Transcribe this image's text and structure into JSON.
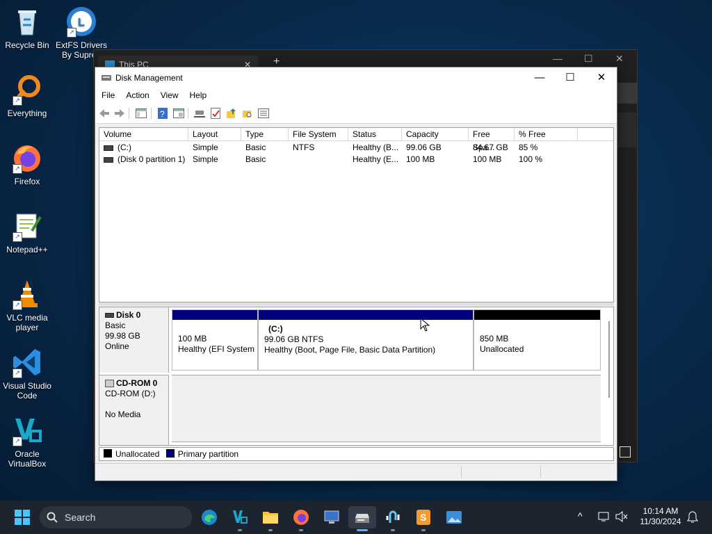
{
  "desktop": {
    "icons": [
      {
        "label": "Recycle Bin"
      },
      {
        "label": "ExtFS Drivers By Supren"
      },
      {
        "label": "Everything"
      },
      {
        "label": "Firefox"
      },
      {
        "label": "Notepad++"
      },
      {
        "label": "VLC media player"
      },
      {
        "label": "Visual Studio Code"
      },
      {
        "label": "Oracle VirtualBox"
      }
    ]
  },
  "background_window": {
    "tab_title": "This PC"
  },
  "window": {
    "title": "Disk Management",
    "menu": [
      "File",
      "Action",
      "View",
      "Help"
    ],
    "columns": [
      "Volume",
      "Layout",
      "Type",
      "File System",
      "Status",
      "Capacity",
      "Free Spa...",
      "% Free"
    ],
    "rows": [
      {
        "volume": "(C:)",
        "layout": "Simple",
        "type": "Basic",
        "fs": "NTFS",
        "status": "Healthy (B...",
        "capacity": "99.06 GB",
        "free": "84.67 GB",
        "pct": "85 %"
      },
      {
        "volume": "(Disk 0 partition 1)",
        "layout": "Simple",
        "type": "Basic",
        "fs": "",
        "status": "Healthy (E...",
        "capacity": "100 MB",
        "free": "100 MB",
        "pct": "100 %"
      }
    ],
    "disks": [
      {
        "name": "Disk 0",
        "type": "Basic",
        "size": "99.98 GB",
        "state": "Online",
        "partitions": [
          {
            "title": "",
            "line1": "100 MB",
            "line2": "Healthy (EFI System"
          },
          {
            "title": "(C:)",
            "line1": "99.06 GB NTFS",
            "line2": "Healthy (Boot, Page File, Basic Data Partition)"
          },
          {
            "title": "",
            "line1": "850 MB",
            "line2": "Unallocated"
          }
        ]
      },
      {
        "name": "CD-ROM 0",
        "type": "CD-ROM (D:)",
        "state": "No Media"
      }
    ],
    "legend": [
      "Unallocated",
      "Primary partition"
    ],
    "colors": {
      "primary": "#00007f",
      "unallocated": "#000000"
    }
  },
  "taskbar": {
    "search_label": "Search",
    "time": "10:14 AM",
    "date": "11/30/2024"
  }
}
